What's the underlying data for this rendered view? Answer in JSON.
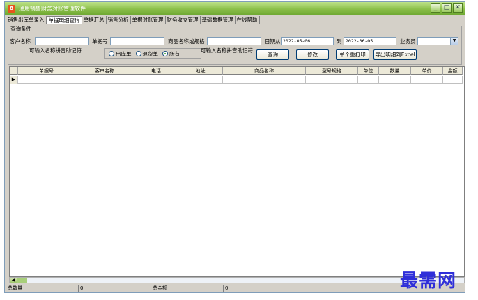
{
  "window": {
    "title": "通用销售财务对账管理软件",
    "app_icon_glyph": "8"
  },
  "title_buttons": {
    "minimize": "_",
    "maximize": "□",
    "close": "✕"
  },
  "menu": [
    {
      "label": "销售出库单录入",
      "active": false
    },
    {
      "label": "单据明细查询",
      "active": true
    },
    {
      "label": "单据汇总",
      "active": false
    },
    {
      "label": "销售分析",
      "active": false
    },
    {
      "label": "单据对账管理",
      "active": false
    },
    {
      "label": "财务收支管理",
      "active": false
    },
    {
      "label": "基础数据管理",
      "active": false
    },
    {
      "label": "在线帮助",
      "active": false
    }
  ],
  "query": {
    "group_title": "查询条件",
    "customer_label": "客户名称",
    "customer_value": "",
    "customer_hint": "可输入名称拼音助记符",
    "doc_no_label": "单据号",
    "doc_no_value": "",
    "product_label": "商品名称或规格",
    "product_value": "",
    "product_hint": "可输入名称拼音助记符",
    "date_from_label": "日期从",
    "date_from_value": "2022-05-06",
    "date_to_label": "到",
    "date_to_value": "2022-06-05",
    "salesman_label": "业务员",
    "salesman_value": "",
    "radio": [
      {
        "label": "出库单",
        "checked": false
      },
      {
        "label": "退货单",
        "checked": false
      },
      {
        "label": "所有",
        "checked": true
      }
    ],
    "buttons": {
      "search": "查询",
      "modify": "修改",
      "print_single": "单个重打印",
      "export": "导出明细到Excel"
    }
  },
  "grid": {
    "row_indicator": "▶",
    "columns": [
      "单据号",
      "客户名称",
      "电话",
      "地址",
      "商品名称",
      "型号规格",
      "单位",
      "数量",
      "单价",
      "金额"
    ]
  },
  "scrollbar": {
    "left_arrow": "◀"
  },
  "status": {
    "total_qty_label": "总数量",
    "total_qty_value": "0",
    "total_amount_label": "总金额",
    "total_amount_value": "0"
  },
  "watermark": "最需网",
  "colors": {
    "title_green": "#8cc04a",
    "accent_blue": "#2f2fd9"
  }
}
